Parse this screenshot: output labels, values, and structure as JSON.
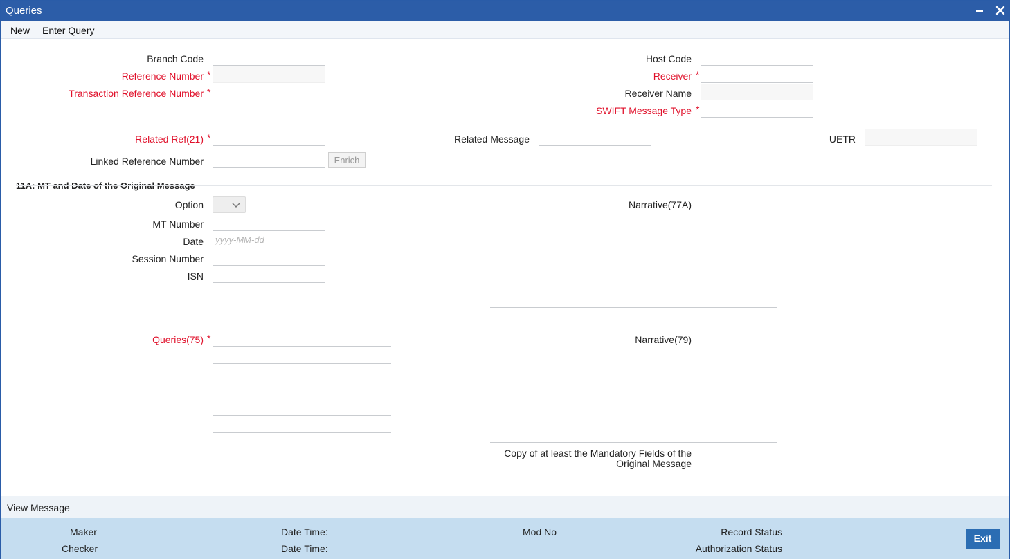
{
  "window": {
    "title": "Queries"
  },
  "menu": {
    "new": "New",
    "enter_query": "Enter Query"
  },
  "fields": {
    "branch_code": {
      "label": "Branch Code",
      "value": ""
    },
    "reference_number": {
      "label": "Reference Number",
      "value": ""
    },
    "transaction_reference_number": {
      "label": "Transaction Reference Number",
      "value": ""
    },
    "host_code": {
      "label": "Host Code",
      "value": ""
    },
    "receiver": {
      "label": "Receiver",
      "value": ""
    },
    "receiver_name": {
      "label": "Receiver Name",
      "value": ""
    },
    "swift_message_type": {
      "label": "SWIFT Message Type",
      "value": ""
    },
    "related_ref": {
      "label": "Related Ref(21)",
      "value": ""
    },
    "related_message": {
      "label": "Related Message",
      "value": ""
    },
    "uetr": {
      "label": "UETR",
      "value": ""
    },
    "linked_reference_number": {
      "label": "Linked Reference Number",
      "value": ""
    },
    "enrich_label": "Enrich"
  },
  "section_11a": {
    "title": "11A: MT and Date of the Original Message",
    "option_label": "Option",
    "mt_number_label": "MT Number",
    "date_label": "Date",
    "date_placeholder": "yyyy-MM-dd",
    "session_number_label": "Session Number",
    "isn_label": "ISN"
  },
  "narratives": {
    "narrative_77a": "Narrative(77A)",
    "queries_75": "Queries(75)",
    "narrative_79": "Narrative(79)",
    "copy_line1": "Copy of at least the Mandatory Fields of the",
    "copy_line2": "Original Message"
  },
  "required_mark": "*",
  "footer": {
    "view_message": "View Message",
    "maker": "Maker",
    "checker": "Checker",
    "date_time_1": "Date Time:",
    "date_time_2": "Date Time:",
    "mod_no": "Mod No",
    "record_status": "Record Status",
    "authorization_status": "Authorization Status",
    "exit": "Exit"
  },
  "colors": {
    "titlebar": "#2c5da8",
    "required": "#e0112b",
    "audit_bar": "#c5ddf0",
    "exit_button": "#2b6db3"
  }
}
